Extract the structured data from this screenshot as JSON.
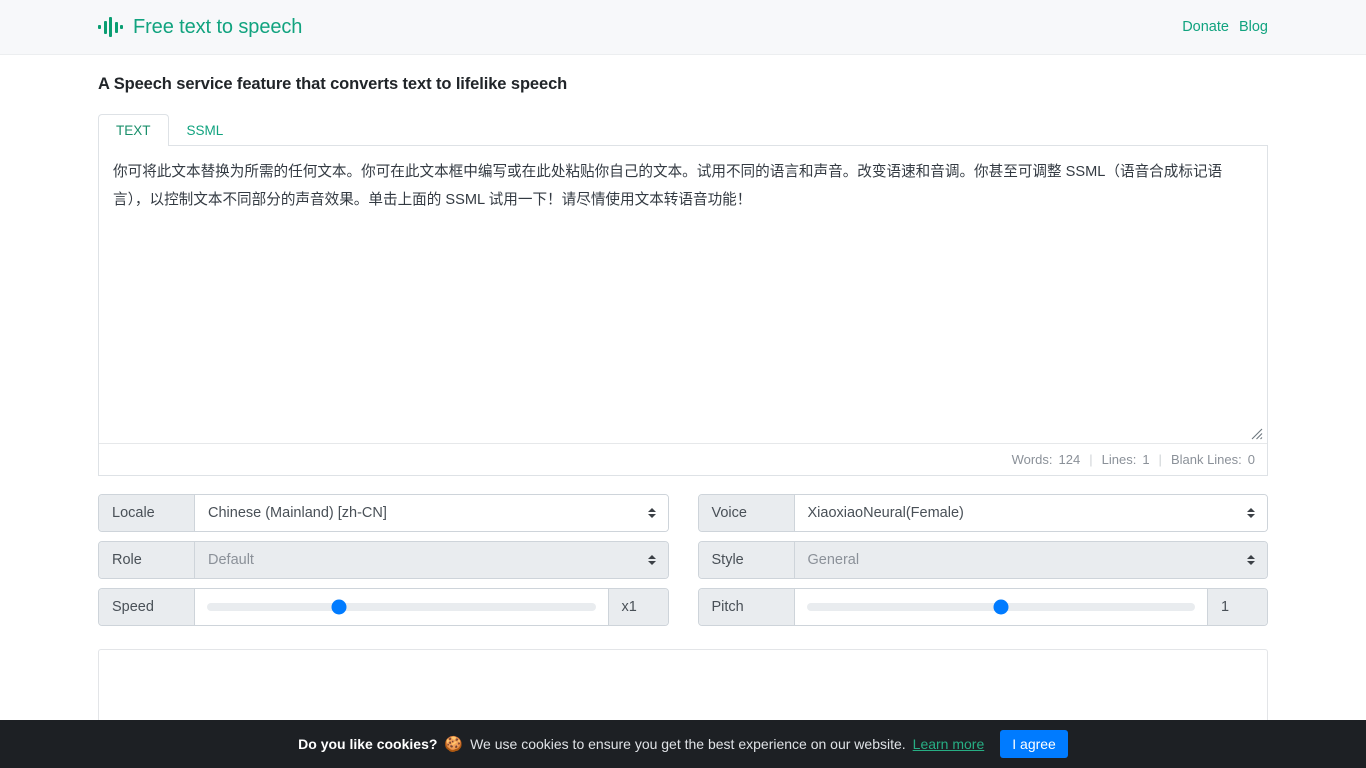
{
  "header": {
    "brand_title": "Free text to speech",
    "logo_icon": "audio-waveform-icon",
    "nav": [
      {
        "label": "Donate"
      },
      {
        "label": "Blog"
      }
    ]
  },
  "main": {
    "page_title": "A Speech service feature that converts text to lifelike speech",
    "tabs": [
      {
        "label": "TEXT",
        "active": true
      },
      {
        "label": "SSML",
        "active": false
      }
    ],
    "editor": {
      "value": "你可将此文本替换为所需的任何文本。你可在此文本框中编写或在此处粘贴你自己的文本。试用不同的语言和声音。改变语速和音调。你甚至可调整 SSML（语音合成标记语言），以控制文本不同部分的声音效果。单击上面的 SSML 试用一下！请尽情使用文本转语音功能！",
      "placeholder": ""
    },
    "status": {
      "words_label": "Words:",
      "words_value": "124",
      "lines_label": "Lines:",
      "lines_value": "1",
      "blank_lines_label": "Blank Lines:",
      "blank_lines_value": "0",
      "separator": "|"
    },
    "controls": {
      "locale": {
        "label": "Locale",
        "value": "Chinese (Mainland) [zh-CN]",
        "disabled": false
      },
      "voice": {
        "label": "Voice",
        "value": "XiaoxiaoNeural(Female)",
        "disabled": false
      },
      "role": {
        "label": "Role",
        "value": "Default",
        "disabled": true
      },
      "style": {
        "label": "Style",
        "value": "General",
        "disabled": true
      },
      "speed": {
        "label": "Speed",
        "value": "x1",
        "percent": 34
      },
      "pitch": {
        "label": "Pitch",
        "value": "1",
        "percent": 50
      }
    }
  },
  "cookie_bar": {
    "question": "Do you like cookies?",
    "emoji": "🍪",
    "message": "We use cookies to ensure you get the best experience on our website.",
    "learn_more": "Learn more",
    "agree_label": "I agree"
  },
  "colors": {
    "brand": "#11a37f",
    "accent": "#007bff",
    "cookie_bg": "#1d2024",
    "link_green": "#27ae84"
  }
}
